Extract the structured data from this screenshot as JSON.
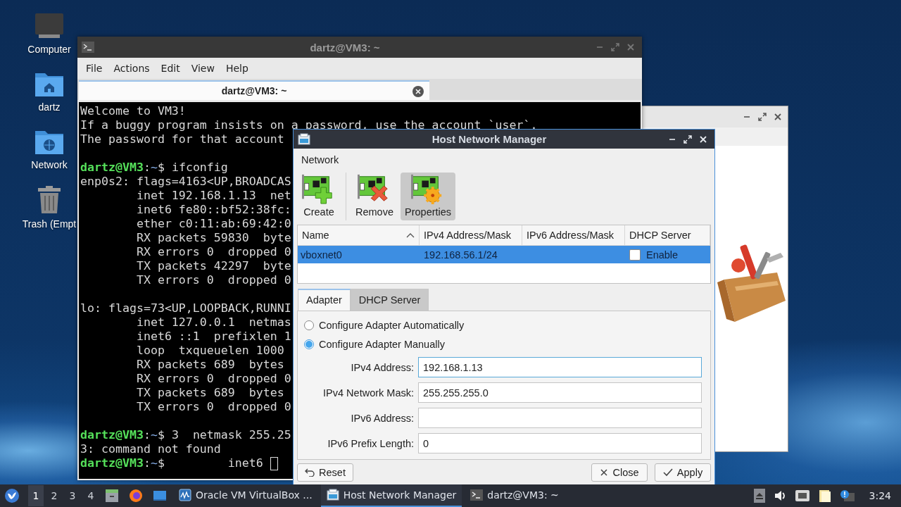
{
  "desktop_icons": [
    {
      "label": "Computer",
      "kind": "computer"
    },
    {
      "label": "dartz",
      "kind": "home"
    },
    {
      "label": "Network",
      "kind": "network"
    },
    {
      "label": "Trash (Empt",
      "kind": "trash"
    }
  ],
  "terminal": {
    "title": "dartz@VM3: ~",
    "menu": [
      "File",
      "Actions",
      "Edit",
      "View",
      "Help"
    ],
    "tab": {
      "label": "dartz@VM3: ~",
      "selected": true
    },
    "lines": [
      {
        "kind": "text",
        "text": "Welcome to VM3!"
      },
      {
        "kind": "text",
        "text": "If a buggy program insists on a password, use the account `user`."
      },
      {
        "kind": "text",
        "text": "The password for that account"
      },
      {
        "kind": "blank"
      },
      {
        "kind": "prompt",
        "user": "dartz@VM3",
        "sep": ":",
        "path": "~",
        "mark": "$",
        "command": " ifconfig"
      },
      {
        "kind": "text",
        "text": "enp0s2: flags=4163<UP,BROADCAS"
      },
      {
        "kind": "text",
        "text": "        inet 192.168.1.13  net"
      },
      {
        "kind": "text",
        "text": "        inet6 fe80::bf52:38fc:"
      },
      {
        "kind": "text",
        "text": "        ether c0:11:ab:69:42:0"
      },
      {
        "kind": "text",
        "text": "        RX packets 59830  byte"
      },
      {
        "kind": "text",
        "text": "        RX errors 0  dropped 0"
      },
      {
        "kind": "text",
        "text": "        TX packets 42297  byte"
      },
      {
        "kind": "text",
        "text": "        TX errors 0  dropped 0"
      },
      {
        "kind": "blank"
      },
      {
        "kind": "text",
        "text": "lo: flags=73<UP,LOOPBACK,RUNNI"
      },
      {
        "kind": "text",
        "text": "        inet 127.0.0.1  netmas"
      },
      {
        "kind": "text",
        "text": "        inet6 ::1  prefixlen 1"
      },
      {
        "kind": "text",
        "text": "        loop  txqueuelen 1000"
      },
      {
        "kind": "text",
        "text": "        RX packets 689  bytes"
      },
      {
        "kind": "text",
        "text": "        RX errors 0  dropped 0"
      },
      {
        "kind": "text",
        "text": "        TX packets 689  bytes"
      },
      {
        "kind": "text",
        "text": "        TX errors 0  dropped 0"
      },
      {
        "kind": "blank"
      },
      {
        "kind": "prompt",
        "user": "dartz@VM3",
        "sep": ":",
        "path": "~",
        "mark": "$",
        "command": " 3  netmask 255.25"
      },
      {
        "kind": "text",
        "text": "3: command not found"
      },
      {
        "kind": "prompt",
        "user": "dartz@VM3",
        "sep": ":",
        "path": "~",
        "mark": "$",
        "command": "         inet6 ",
        "cursor": true
      }
    ]
  },
  "dialog": {
    "title": "Host Network Manager",
    "menu": [
      "Network"
    ],
    "toolbar": [
      {
        "label": "Create",
        "kind": "create",
        "selected": false
      },
      {
        "label": "Remove",
        "kind": "remove",
        "selected": false
      },
      {
        "label": "Properties",
        "kind": "properties",
        "selected": true
      }
    ],
    "table": {
      "columns": [
        {
          "label": "Name",
          "sorted": true
        },
        {
          "label": "IPv4 Address/Mask",
          "sorted": false
        },
        {
          "label": "IPv6 Address/Mask",
          "sorted": false
        },
        {
          "label": "DHCP Server",
          "sorted": false
        }
      ],
      "rows": [
        {
          "name": "vboxnet0",
          "ipv4": "192.168.56.1/24",
          "dhcp_enabled": false,
          "dhcp_label": "Enable",
          "selected": true
        }
      ]
    },
    "tabs": [
      {
        "label": "Adapter",
        "selected": true
      },
      {
        "label": "DHCP Server",
        "selected": false
      }
    ],
    "radios": [
      {
        "label": "Configure Adapter Automatically",
        "selected": false
      },
      {
        "label": "Configure Adapter Manually",
        "selected": true
      }
    ],
    "fields": [
      {
        "label": "IPv4 Address:",
        "value": "192.168.1.13",
        "focused": true
      },
      {
        "label": "IPv4 Network Mask:",
        "value": "255.255.255.0",
        "focused": false
      },
      {
        "label": "IPv6 Address:",
        "focused": false
      },
      {
        "label": "IPv6 Prefix Length:",
        "value": "0",
        "focused": false
      }
    ],
    "buttons": [
      {
        "label": "Reset",
        "kind": "reset"
      },
      {
        "label": "Close",
        "kind": "close"
      },
      {
        "label": "Apply",
        "kind": "apply"
      }
    ]
  },
  "taskbar": {
    "workspaces": [
      {
        "label": "1",
        "selected": true
      },
      {
        "label": "2",
        "selected": false
      },
      {
        "label": "3",
        "selected": false
      },
      {
        "label": "4",
        "selected": false
      }
    ],
    "tasks": [
      {
        "label": "Oracle VM VirtualBox ...",
        "kind": "virtualbox",
        "selected": false
      },
      {
        "label": "Host Network Manager",
        "kind": "dialog",
        "selected": true
      },
      {
        "label": "dartz@VM3: ~",
        "kind": "terminal",
        "selected": false
      }
    ],
    "clock": "3:24"
  }
}
